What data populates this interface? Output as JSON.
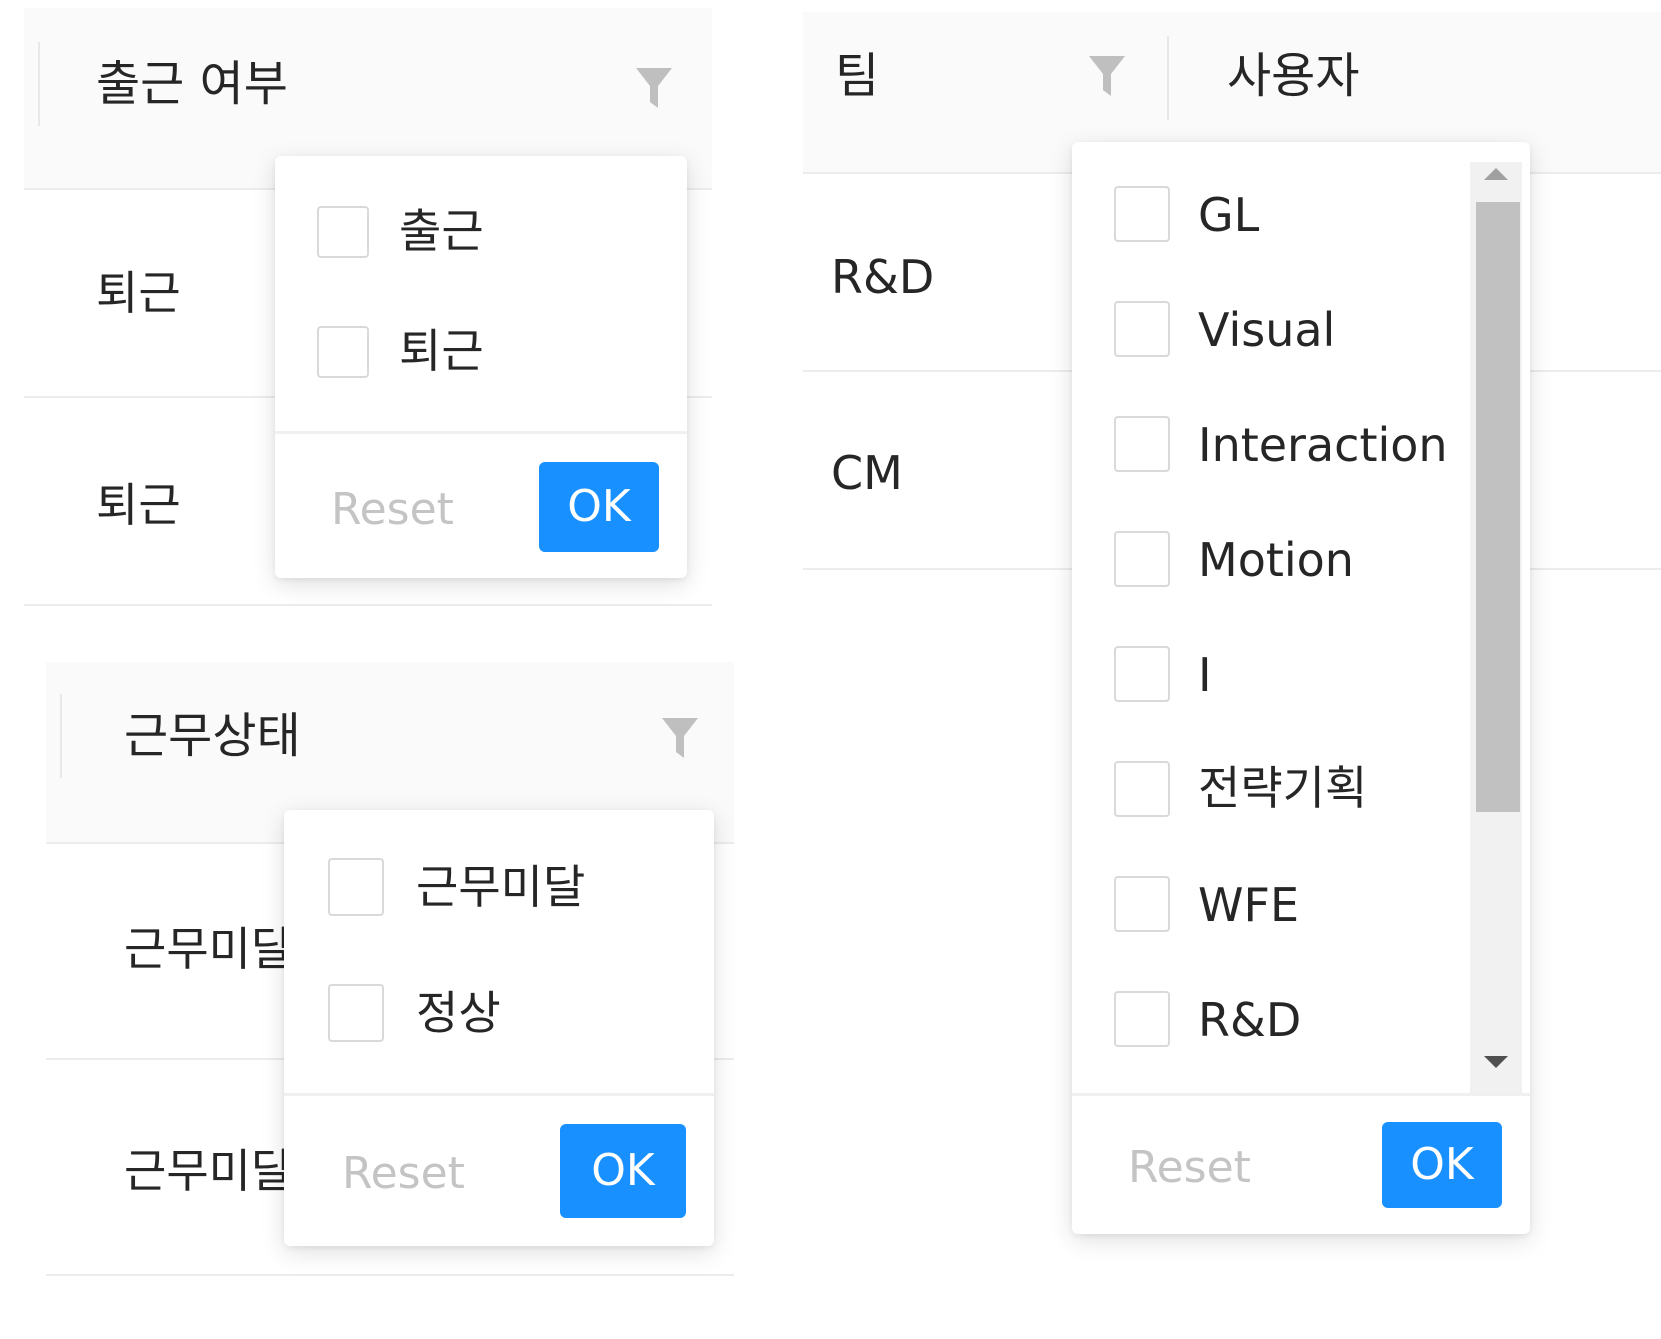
{
  "panel_attendance": {
    "column_title": "출근 여부",
    "rows": [
      "퇴근",
      "퇴근"
    ],
    "dropdown": {
      "options": [
        "출근",
        "퇴근"
      ],
      "reset_label": "Reset",
      "ok_label": "OK"
    }
  },
  "panel_work_status": {
    "column_title": "근무상태",
    "rows": [
      "근무미달",
      "근무미달"
    ],
    "dropdown": {
      "options": [
        "근무미달",
        "정상"
      ],
      "reset_label": "Reset",
      "ok_label": "OK"
    }
  },
  "panel_team": {
    "column_title": "팀",
    "next_column_title": "사용자",
    "rows": [
      "R&D",
      "CM"
    ],
    "dropdown": {
      "options": [
        "GL",
        "Visual",
        "Interaction",
        "Motion",
        "I",
        "전략기획",
        "WFE",
        "R&D"
      ],
      "reset_label": "Reset",
      "ok_label": "OK"
    }
  },
  "colors": {
    "primary": "#1890ff",
    "header_bg": "#fafafa",
    "border": "#d9d9d9",
    "disabled_text": "#c4c4c4",
    "filter_icon": "#bfbfbf"
  },
  "icons": {
    "filter": "filter-funnel-icon",
    "scroll_up": "caret-up-icon",
    "scroll_down": "caret-down-icon"
  }
}
